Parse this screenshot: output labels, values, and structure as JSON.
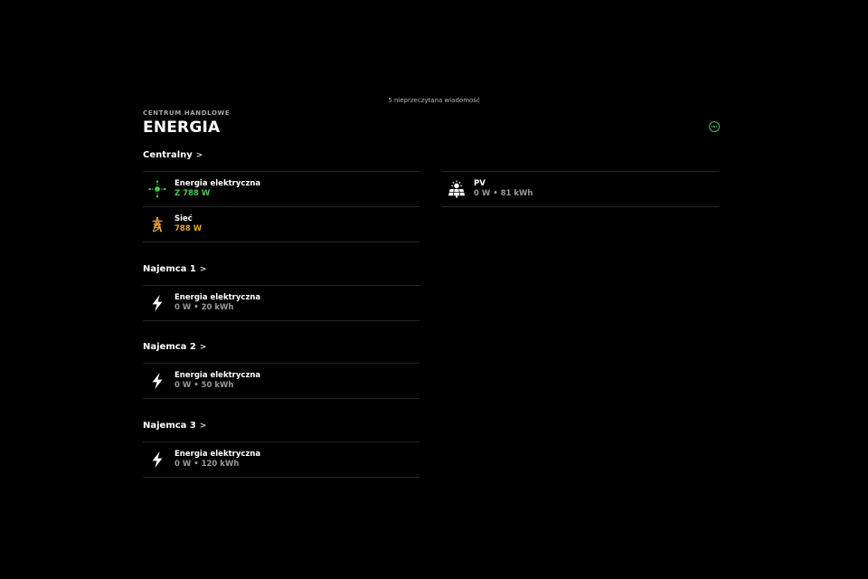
{
  "notice": "5 nieprzeczytana wiadomość",
  "header": {
    "subtitle": "CENTRUM HANDLOWE",
    "title": "ENERGIA"
  },
  "sections": [
    {
      "title": "Centralny",
      "chevron": ">",
      "rows": [
        {
          "name": "Energia elektryczna",
          "value": "Z 788 W",
          "icon": "energy-flow-icon",
          "value_color": "#47c84a"
        },
        {
          "name": "Sieć",
          "value": "788 W",
          "icon": "power-tower-icon",
          "value_color": "#e6a23c"
        }
      ],
      "rows_right": [
        {
          "name": "PV",
          "value": "0 W • 81 kWh",
          "icon": "solar-panel-icon"
        }
      ]
    },
    {
      "title": "Najemca 1",
      "chevron": ">",
      "rows": [
        {
          "name": "Energia elektryczna",
          "value": "0 W • 20 kWh",
          "icon": "lightning-icon"
        }
      ]
    },
    {
      "title": "Najemca 2",
      "chevron": ">",
      "rows": [
        {
          "name": "Energia elektryczna",
          "value": "0 W • 50 kWh",
          "icon": "lightning-icon"
        }
      ]
    },
    {
      "title": "Najemca 3",
      "chevron": ">",
      "rows": [
        {
          "name": "Energia elektryczna",
          "value": "0 W • 120 kWh",
          "icon": "lightning-icon"
        }
      ]
    }
  ],
  "colors": {
    "accent": "#4ab84a",
    "grid_value": "#e6a23c",
    "positive_value": "#47c84a",
    "muted_value": "#9a9a9a"
  }
}
